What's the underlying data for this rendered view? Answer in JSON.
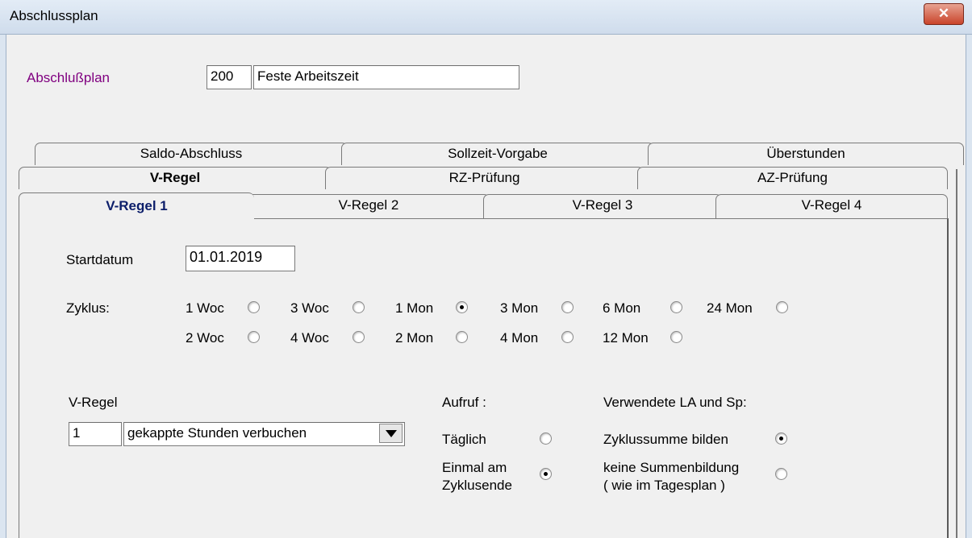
{
  "window": {
    "title": "Abschlussplan",
    "close_glyph": "✕"
  },
  "header": {
    "label": "Abschlußplan",
    "number": "200",
    "name": "Feste Arbeitszeit"
  },
  "tabs_row1": [
    "Saldo-Abschluss",
    "Sollzeit-Vorgabe",
    "Überstunden"
  ],
  "tabs_row2": [
    "V-Regel",
    "RZ-Prüfung",
    "AZ-Prüfung"
  ],
  "tabs_row3": [
    "V-Regel 1",
    "V-Regel 2",
    "V-Regel 3",
    "V-Regel 4"
  ],
  "startdatum": {
    "label": "Startdatum",
    "value": "01.01.2019"
  },
  "zyklus": {
    "label": "Zyklus:",
    "options": [
      {
        "label": "1 Woc",
        "selected": false
      },
      {
        "label": "3 Woc",
        "selected": false
      },
      {
        "label": "1 Mon",
        "selected": true
      },
      {
        "label": "3 Mon",
        "selected": false
      },
      {
        "label": "6 Mon",
        "selected": false
      },
      {
        "label": "24 Mon",
        "selected": false
      },
      {
        "label": "2 Woc",
        "selected": false
      },
      {
        "label": "4 Woc",
        "selected": false
      },
      {
        "label": "2 Mon",
        "selected": false
      },
      {
        "label": "4 Mon",
        "selected": false
      },
      {
        "label": "12 Mon",
        "selected": false
      }
    ]
  },
  "vregel": {
    "label": "V-Regel",
    "number": "1",
    "value": "gekappte Stunden verbuchen"
  },
  "aufruf": {
    "label": "Aufruf :",
    "options": [
      {
        "label": "Täglich",
        "selected": false
      },
      {
        "label": "Einmal am",
        "label2": "Zyklusende",
        "selected": true
      }
    ]
  },
  "verwendete": {
    "label": "Verwendete LA und Sp:",
    "options": [
      {
        "label": "Zyklussumme bilden",
        "selected": true
      },
      {
        "label": "keine Summenbildung",
        "label2": "( wie im Tagesplan )",
        "selected": false
      }
    ]
  }
}
